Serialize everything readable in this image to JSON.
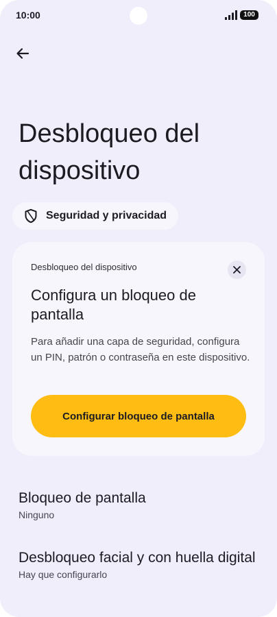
{
  "status_bar": {
    "time": "10:00",
    "battery": "100"
  },
  "header": {
    "back_icon": "arrow-left-icon",
    "title": "Desbloqueo del dispositivo"
  },
  "breadcrumb_chip": {
    "icon": "shield-icon",
    "label": "Seguridad y privacidad"
  },
  "card": {
    "overline": "Desbloqueo del dispositivo",
    "title": "Configura un bloqueo de pantalla",
    "body": "Para añadir una capa de seguridad, configura un PIN, patrón o contraseña en este dispositivo.",
    "button_label": "Configurar bloqueo de pantalla",
    "close_icon": "close-icon",
    "accent_color": "#ffbd14"
  },
  "settings": [
    {
      "title": "Bloqueo de pantalla",
      "subtitle": "Ninguno"
    },
    {
      "title": "Desbloqueo facial y con huella digital",
      "subtitle": "Hay que configurarlo"
    }
  ],
  "colors": {
    "background": "#efeefa",
    "surface": "#f7f6fc",
    "text": "#1c1b22"
  }
}
